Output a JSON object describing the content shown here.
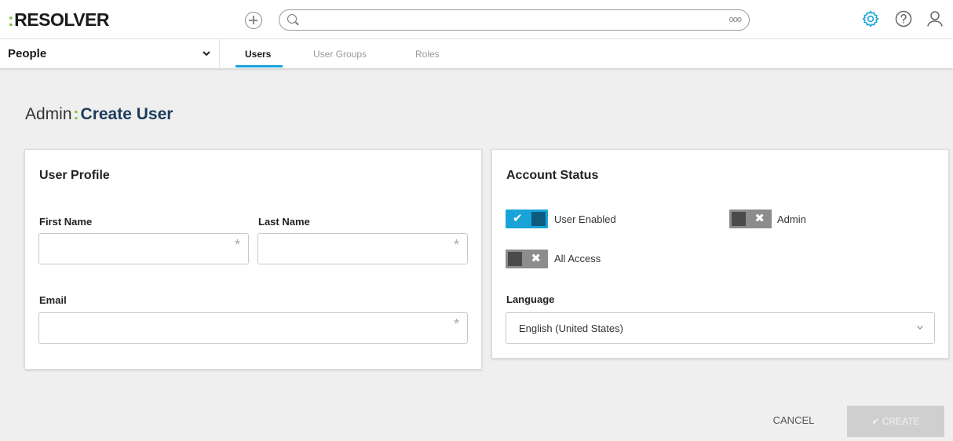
{
  "app": {
    "logo": "RESOLVER",
    "search": {
      "placeholder": "",
      "more_label": "ooo"
    }
  },
  "subnav": {
    "section": "People",
    "tabs": [
      {
        "label": "Users",
        "active": true
      },
      {
        "label": "User Groups",
        "active": false
      },
      {
        "label": "Roles",
        "active": false
      }
    ]
  },
  "page": {
    "title_prefix": "Admin",
    "title_main": "Create User"
  },
  "profile": {
    "title": "User Profile",
    "first_name_label": "First Name",
    "first_name_value": "",
    "last_name_label": "Last Name",
    "last_name_value": "",
    "email_label": "Email",
    "email_value": "",
    "required_mark": "*"
  },
  "status": {
    "title": "Account Status",
    "toggles": [
      {
        "label": "User Enabled",
        "on": true
      },
      {
        "label": "Admin",
        "on": false
      },
      {
        "label": "All Access",
        "on": false
      }
    ],
    "language_label": "Language",
    "language_value": "English (United States)"
  },
  "actions": {
    "cancel": "CANCEL",
    "create": "CREATE"
  },
  "colors": {
    "accent": "#1aa3d9",
    "brand_green": "#7bc043",
    "title_navy": "#1d3c5c"
  }
}
